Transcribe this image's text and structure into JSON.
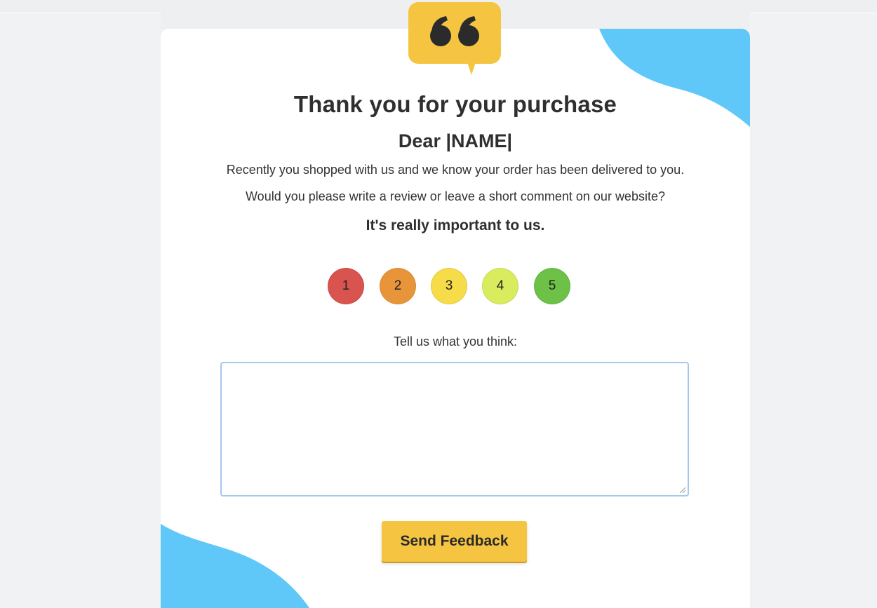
{
  "email": {
    "title": "Thank you for your purchase",
    "greeting": "Dear |NAME|",
    "paragraph_1": "Recently you shopped with us and we know your order has been delivered to you.",
    "paragraph_2": "Would you please write a review or leave a short comment on our website?",
    "emphasis": "It's really important to us.",
    "rating": {
      "options": [
        {
          "label": "1",
          "color": "#d9534f"
        },
        {
          "label": "2",
          "color": "#e8953a"
        },
        {
          "label": "3",
          "color": "#f6dc48"
        },
        {
          "label": "4",
          "color": "#d9ec5e"
        },
        {
          "label": "5",
          "color": "#6cc146"
        }
      ]
    },
    "comment": {
      "prompt": "Tell us what you think:",
      "value": "",
      "placeholder": ""
    },
    "send_label": "Send Feedback"
  },
  "colors": {
    "accent_yellow": "#f5c542",
    "blob_blue": "#5fc8f8",
    "background": "#f0f2f4",
    "card": "#ffffff",
    "text": "#2f2f2f"
  },
  "icons": {
    "badge": "quote-bubble-icon",
    "grip": "resize-grip-icon"
  }
}
